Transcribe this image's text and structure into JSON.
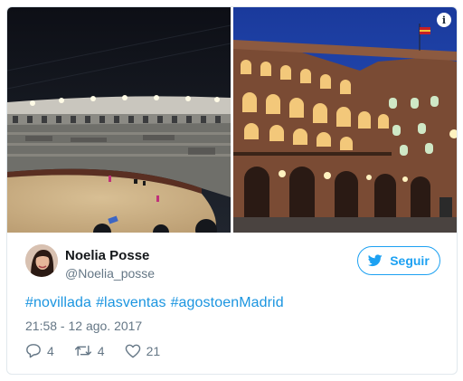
{
  "user": {
    "name": "Noelia Posse",
    "handle": "@Noelia_posse"
  },
  "follow_button": {
    "label": "Seguir"
  },
  "tweet": {
    "hashtags": [
      "#novillada",
      "#lasventas",
      "#agostoenMadrid"
    ],
    "timestamp": "21:58 - 12 ago. 2017"
  },
  "actions": {
    "reply_count": "4",
    "retweet_count": "4",
    "like_count": "21"
  },
  "media": {
    "info_glyph": "i",
    "left_image": "bullring-arena-photo",
    "right_image": "las-ventas-facade-photo"
  },
  "colors": {
    "accent": "#1da1f2",
    "link": "#1b95e0",
    "muted": "#657786",
    "text": "#14171a",
    "border": "#e1e8ed"
  }
}
